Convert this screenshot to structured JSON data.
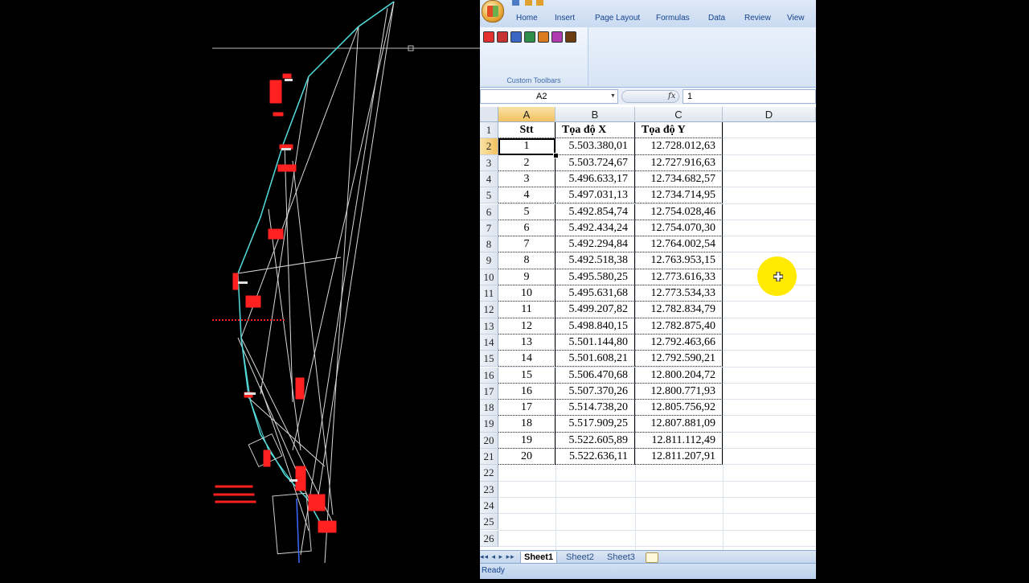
{
  "ribbon": {
    "tabs": [
      "Home",
      "Insert",
      "Page Layout",
      "Formulas",
      "Data",
      "Review",
      "View"
    ],
    "group_label": "Custom Toolbars",
    "toolbar_icon_colors": [
      "#e53030",
      "#c83232",
      "#3a66c4",
      "#2f8f4a",
      "#d97b1e",
      "#b03bb0",
      "#6a3c10"
    ]
  },
  "formula_bar": {
    "name_box": "A2",
    "fx_label": "fx",
    "content": "1"
  },
  "columns": [
    "A",
    "B",
    "C",
    "D"
  ],
  "row_numbers": [
    "1",
    "2",
    "3",
    "4",
    "5",
    "6",
    "7",
    "8",
    "9",
    "10",
    "11",
    "12",
    "13",
    "14",
    "15",
    "16",
    "17",
    "18",
    "19",
    "20",
    "21",
    "22",
    "23",
    "24",
    "25",
    "26"
  ],
  "table": {
    "headers": [
      "Stt",
      "Tọa độ X",
      "Tọa độ Y"
    ],
    "rows": [
      [
        "1",
        "5.503.380,01",
        "12.728.012,63"
      ],
      [
        "2",
        "5.503.724,67",
        "12.727.916,63"
      ],
      [
        "3",
        "5.496.633,17",
        "12.734.682,57"
      ],
      [
        "4",
        "5.497.031,13",
        "12.734.714,95"
      ],
      [
        "5",
        "5.492.854,74",
        "12.754.028,46"
      ],
      [
        "6",
        "5.492.434,24",
        "12.754.070,30"
      ],
      [
        "7",
        "5.492.294,84",
        "12.764.002,54"
      ],
      [
        "8",
        "5.492.518,38",
        "12.763.953,15"
      ],
      [
        "9",
        "5.495.580,25",
        "12.773.616,33"
      ],
      [
        "10",
        "5.495.631,68",
        "12.773.534,33"
      ],
      [
        "11",
        "5.499.207,82",
        "12.782.834,79"
      ],
      [
        "12",
        "5.498.840,15",
        "12.782.875,40"
      ],
      [
        "13",
        "5.501.144,80",
        "12.792.463,66"
      ],
      [
        "14",
        "5.501.608,21",
        "12.792.590,21"
      ],
      [
        "15",
        "5.506.470,68",
        "12.800.204,72"
      ],
      [
        "16",
        "5.507.370,26",
        "12.800.771,93"
      ],
      [
        "17",
        "5.514.738,20",
        "12.805.756,92"
      ],
      [
        "18",
        "5.517.909,25",
        "12.807.881,09"
      ],
      [
        "19",
        "5.522.605,89",
        "12.811.112,49"
      ],
      [
        "20",
        "5.522.636,11",
        "12.811.207,91"
      ]
    ]
  },
  "sheets": {
    "nav": "◂◂ ◂ ▸ ▸▸",
    "tabs": [
      "Sheet1",
      "Sheet2",
      "Sheet3"
    ],
    "active": "Sheet1"
  },
  "status": "Ready",
  "colors": {
    "cad_background": "#000000",
    "cad_red": "#ff2020",
    "cad_cyan": "#55dddd",
    "cad_white": "#e0e0e0",
    "cursor_highlight": "#ffea00"
  }
}
